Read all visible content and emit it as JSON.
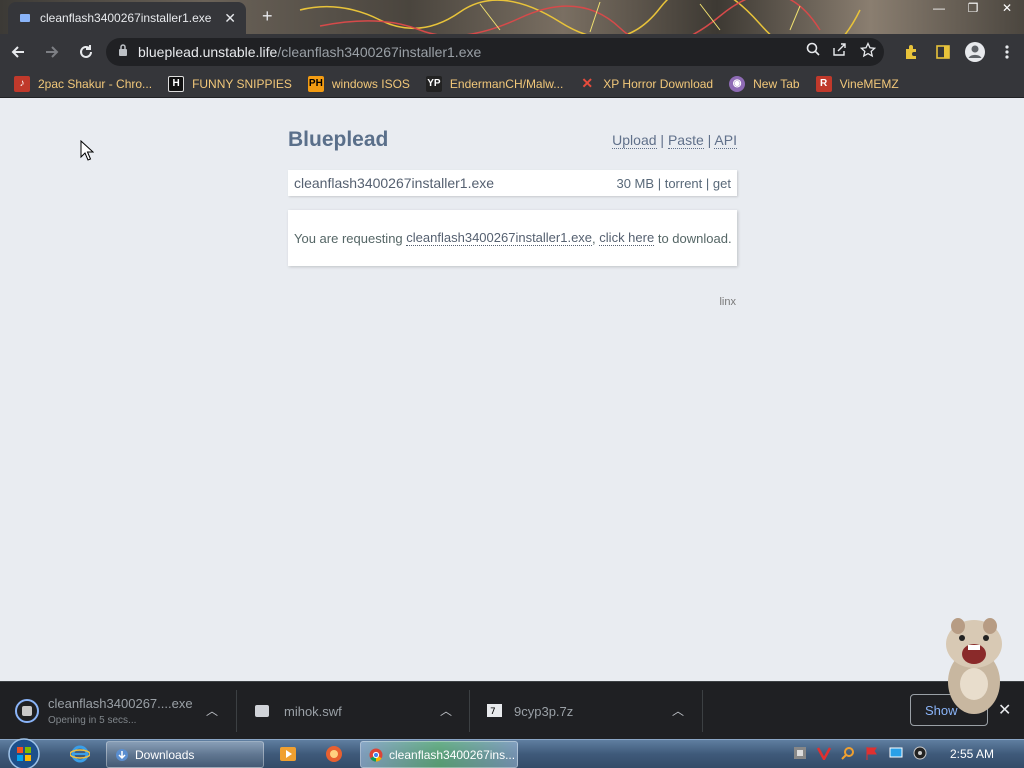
{
  "browser": {
    "tab_title": "cleanflash3400267installer1.exe",
    "url_host": "blueplead.unstable.life",
    "url_path": "/cleanflash3400267installer1.exe"
  },
  "bookmarks": [
    {
      "label": "2pac Shakur - Chro...",
      "icon": "album-icon",
      "color": "#c0392b"
    },
    {
      "label": "FUNNY SNIPPIES",
      "icon": "H",
      "color": "#111111"
    },
    {
      "label": "windows ISOS",
      "icon": "PH",
      "color": "#f39c12"
    },
    {
      "label": "EndermanCH/Malw...",
      "icon": "YP",
      "color": "#222222"
    },
    {
      "label": "XP Horror Download",
      "icon": "X",
      "color": "#c0392b"
    },
    {
      "label": "New Tab",
      "icon": "globe-icon",
      "color": "#9b59b6"
    },
    {
      "label": "VineMEMZ",
      "icon": "R",
      "color": "#c0392b"
    }
  ],
  "site": {
    "brand": "Blueplead",
    "nav_upload": "Upload",
    "nav_paste": "Paste",
    "nav_api": "API",
    "nav_sep": "|",
    "file_name": "cleanflash3400267installer1.exe",
    "file_size": "30 MB",
    "link_torrent": "torrent",
    "link_get": "get",
    "msg_prefix": "You are requesting",
    "msg_file": "cleanflash3400267installer1.exe",
    "msg_comma": ",",
    "msg_click": "click here",
    "msg_suffix": "to download.",
    "footer": "linx"
  },
  "downloads": [
    {
      "name": "cleanflash3400267....exe",
      "status": "Opening in 5 secs..."
    },
    {
      "name": "mihok.swf",
      "status": ""
    },
    {
      "name": "9cyp3p.7z",
      "status": ""
    }
  ],
  "shelf": {
    "show_all": "Show"
  },
  "taskbar": {
    "item_downloads": "Downloads",
    "item_chrome": "cleanflash3400267ins...",
    "clock": "2:55 AM"
  }
}
